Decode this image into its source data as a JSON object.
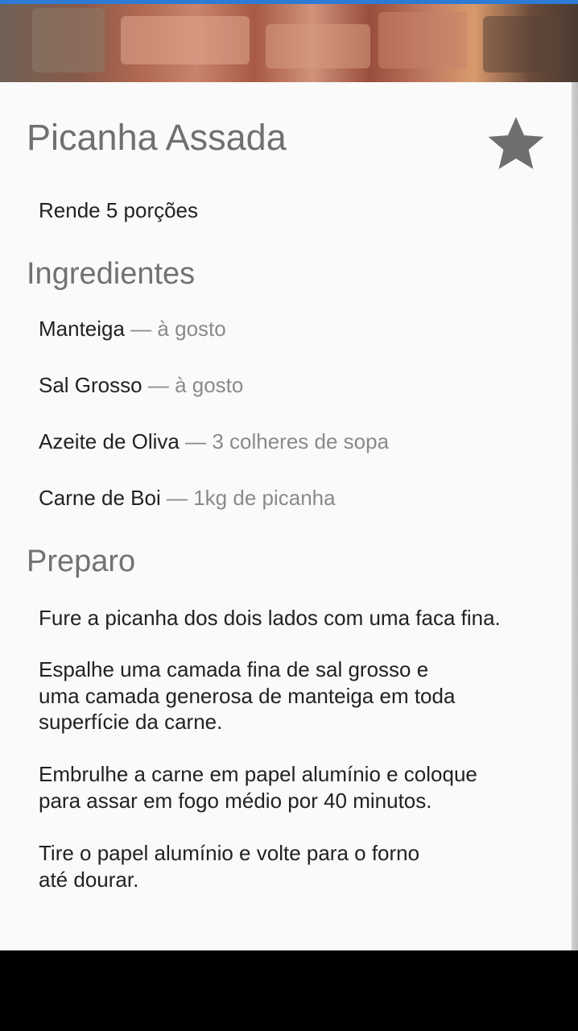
{
  "recipe": {
    "title": "Picanha Assada",
    "favorite_icon": "star-icon",
    "yield": "Rende 5 porções"
  },
  "ingredients": {
    "heading": "Ingredientes",
    "separator": " — ",
    "items": [
      {
        "name": "Manteiga",
        "qty": "à gosto"
      },
      {
        "name": "Sal Grosso",
        "qty": "à gosto"
      },
      {
        "name": "Azeite de Oliva",
        "qty": "3 colheres de sopa"
      },
      {
        "name": "Carne de Boi",
        "qty": "1kg de picanha"
      }
    ]
  },
  "preparation": {
    "heading": "Preparo",
    "steps": [
      {
        "lines": [
          "Fure a picanha dos dois lados com uma faca fina."
        ]
      },
      {
        "lines": [
          "Espalhe uma camada fina de sal grosso e",
          "uma camada generosa de manteiga em toda",
          "superfície da carne."
        ]
      },
      {
        "lines": [
          "Embrulhe a carne em papel alumínio e coloque",
          "para assar em fogo médio por 40 minutos."
        ]
      },
      {
        "lines": [
          "Tire o papel alumínio e volte para o forno",
          "até dourar."
        ]
      }
    ]
  },
  "colors": {
    "title": "#707070",
    "section_heading": "#727272",
    "body_text": "#222222",
    "secondary_text": "#8a8a8a",
    "star": "#6e6e6e",
    "background": "#fafafa",
    "accent_bar": "#2e7bd6"
  }
}
